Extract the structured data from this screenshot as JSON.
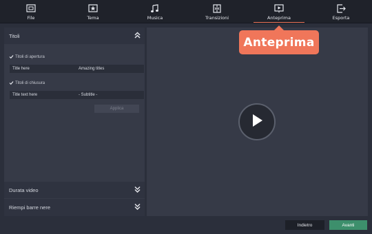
{
  "toolbar": {
    "tabs": [
      {
        "label": "File",
        "icon": "file-icon"
      },
      {
        "label": "Tema",
        "icon": "theme-star-icon"
      },
      {
        "label": "Musica",
        "icon": "music-note-icon"
      },
      {
        "label": "Transizioni",
        "icon": "transitions-icon"
      },
      {
        "label": "Anteprima",
        "icon": "preview-play-icon",
        "active": true
      },
      {
        "label": "Esporta",
        "icon": "export-icon"
      }
    ]
  },
  "callout": {
    "label": "Anteprima",
    "color": "#f0765a"
  },
  "left_panel": {
    "titles_section": {
      "header": "Titoli",
      "opening": {
        "checkbox_label": "Titoli di apertura",
        "checked": true,
        "title_value": "Title here",
        "subtitle_value": "Amazing titles"
      },
      "closing": {
        "checkbox_label": "Titoli di chiusura",
        "checked": true,
        "title_value": "Title text here",
        "subtitle_value": "- Subtitle -"
      },
      "apply_label": "Applica"
    },
    "duration_section": {
      "header": "Durata video"
    },
    "fill_section": {
      "header": "Riempi barre nere"
    }
  },
  "footer": {
    "back_label": "Indietro",
    "next_label": "Avanti",
    "next_color": "#3d8f6c"
  }
}
